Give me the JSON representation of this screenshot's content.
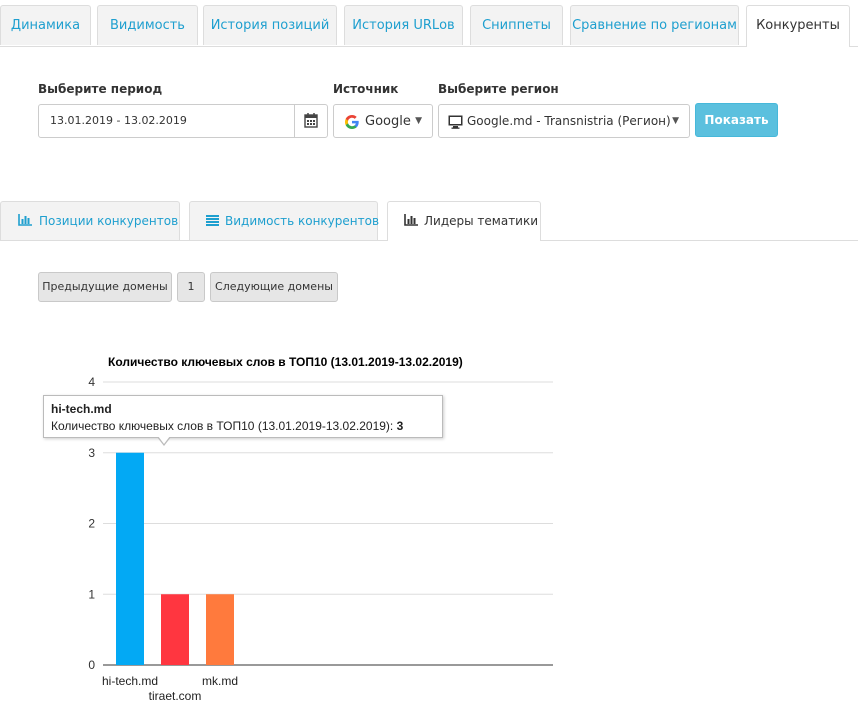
{
  "top_tabs": [
    {
      "label": "Динамика",
      "active": false
    },
    {
      "label": "Видимость",
      "active": false
    },
    {
      "label": "История позиций",
      "active": false
    },
    {
      "label": "История URLов",
      "active": false
    },
    {
      "label": "Сниппеты",
      "active": false
    },
    {
      "label": "Сравнение по регионам",
      "active": false
    },
    {
      "label": "Конкуренты",
      "active": true
    }
  ],
  "filters": {
    "period_label": "Выберите период",
    "period_value": "13.01.2019 - 13.02.2019",
    "source_label": "Источник",
    "source_value": "Google",
    "region_label": "Выберите регион",
    "region_value": "Google.md - Transnistria (Регион)",
    "show_button": "Показать"
  },
  "sub_tabs": [
    {
      "label": "Позиции конкурентов",
      "icon": "bar-chart-icon",
      "active": false
    },
    {
      "label": "Видимость конкурентов",
      "icon": "list-icon",
      "active": false
    },
    {
      "label": "Лидеры тематики",
      "icon": "bar-chart-icon",
      "active": true
    }
  ],
  "pager": {
    "prev_label": "Предыдущие домены",
    "page": "1",
    "next_label": "Следующие домены"
  },
  "tooltip": {
    "title": "hi-tech.md",
    "text": "Количество ключевых слов в ТОП10 (13.01.2019-13.02.2019): ",
    "value": "3"
  },
  "colors": {
    "accent": "#1e9fcf",
    "button_info": "#5bc0de",
    "bar_1": "#03a9f4",
    "bar_2": "#ff3640",
    "bar_3": "#ff7a3d"
  },
  "chart_data": {
    "type": "bar",
    "title": "Количество ключевых слов в ТОП10 (13.01.2019-13.02.2019)",
    "categories": [
      "hi-tech.md",
      "tiraet.com",
      "mk.md"
    ],
    "values": [
      3,
      1,
      1
    ],
    "colors": [
      "#03a9f4",
      "#ff3640",
      "#ff7a3d"
    ],
    "ylim": [
      0,
      4
    ],
    "yticks": [
      "0",
      "1",
      "2",
      "3",
      "4"
    ],
    "xlabel": "",
    "ylabel": "",
    "grid": true,
    "legend": "none"
  }
}
